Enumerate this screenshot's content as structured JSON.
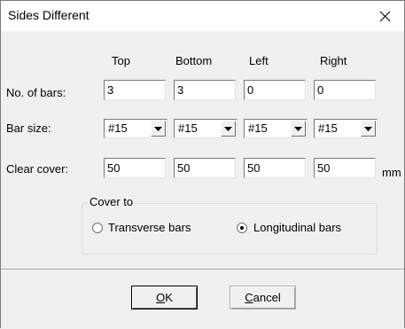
{
  "window": {
    "title": "Sides Different",
    "close_icon": "close-icon",
    "close_glyph": "✕"
  },
  "columns": [
    "Top",
    "Bottom",
    "Left",
    "Right"
  ],
  "rows": {
    "bars": {
      "label": "No. of bars:",
      "values": [
        "3",
        "3",
        "0",
        "0"
      ]
    },
    "bar_size": {
      "label": "Bar size:",
      "values": [
        "#15",
        "#15",
        "#15",
        "#15"
      ]
    },
    "clear_cover": {
      "label": "Clear cover:",
      "values": [
        "50",
        "50",
        "50",
        "50"
      ],
      "unit": "mm"
    }
  },
  "cover_to": {
    "label": "Cover to",
    "options": [
      "Transverse bars",
      "Longitudinal bars"
    ],
    "selected": "Longitudinal bars"
  },
  "buttons": {
    "ok_mnemonic": "O",
    "ok_rest": "K",
    "cancel_mnemonic": "C",
    "cancel_rest": "ancel"
  },
  "colors": {
    "dialog_bg": "#f0f0f0",
    "titlebar_bg": "#ffffff"
  }
}
